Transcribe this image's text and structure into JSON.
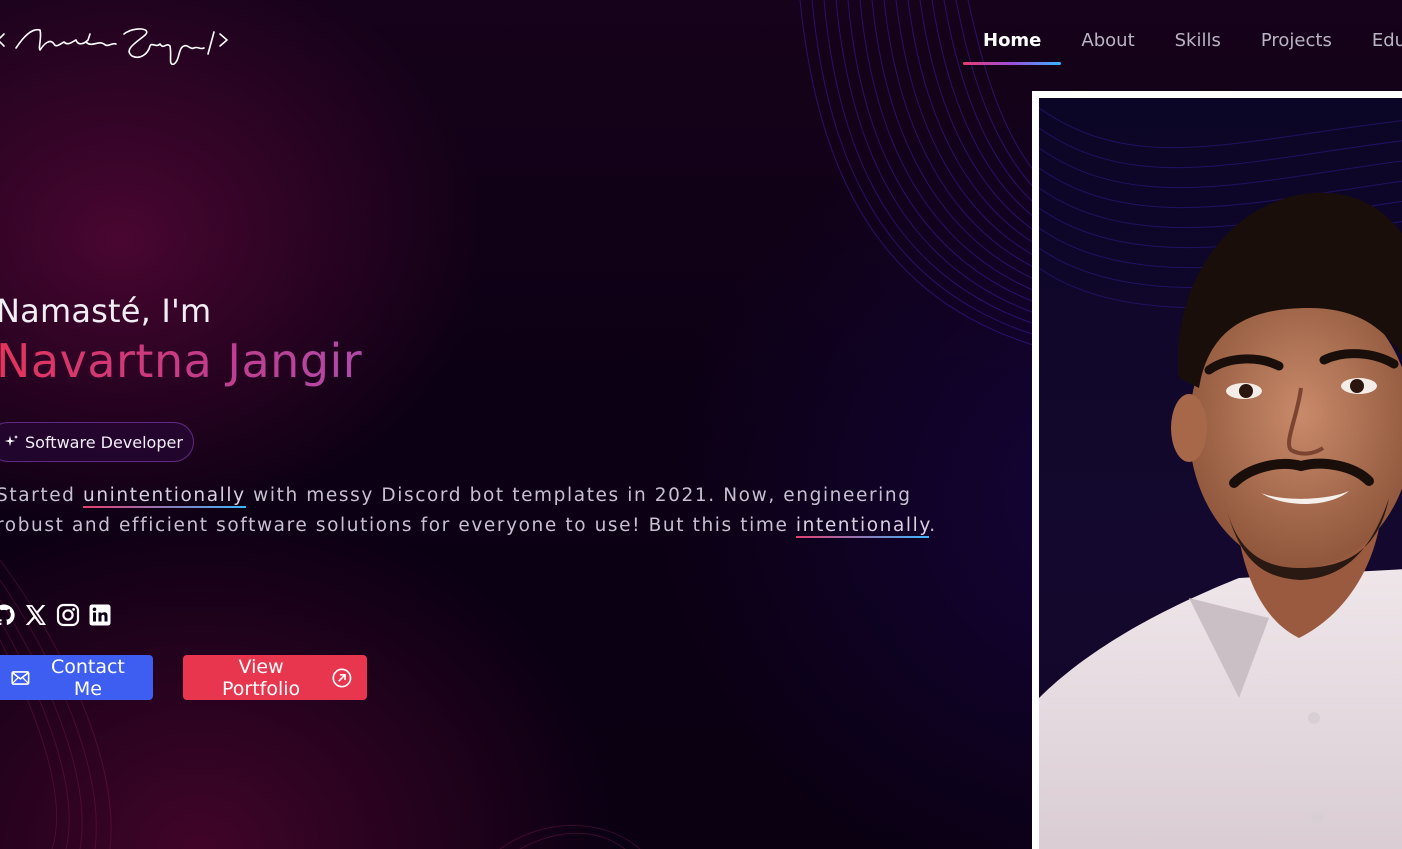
{
  "header": {
    "logo_text": "< Navartna Jangir />",
    "nav": [
      {
        "label": "Home",
        "active": true
      },
      {
        "label": "About",
        "active": false
      },
      {
        "label": "Skills",
        "active": false
      },
      {
        "label": "Projects",
        "active": false
      },
      {
        "label": "Educa",
        "active": false
      }
    ]
  },
  "hero": {
    "greeting": "Namasté, I'm",
    "name": "Navartna Jangir",
    "role": "Software Developer",
    "bio": {
      "part1": "Started ",
      "highlight1": "unintentionally",
      "part2": " with messy Discord bot templates in 2021. Now, engineering robust and efficient software solutions for everyone to use! But this time ",
      "highlight2": "intentionally",
      "part3": "."
    },
    "socials": [
      "github-icon",
      "x-icon",
      "instagram-icon",
      "linkedin-icon"
    ],
    "buttons": {
      "contact": "Contact Me",
      "portfolio": "View Portfolio"
    }
  },
  "colors": {
    "contact_button": "#3d5ef0",
    "portfolio_button": "#e8364f",
    "name_gradient_start": "#e4345a",
    "name_gradient_end": "#b04aa8",
    "background": "#0c0014"
  }
}
